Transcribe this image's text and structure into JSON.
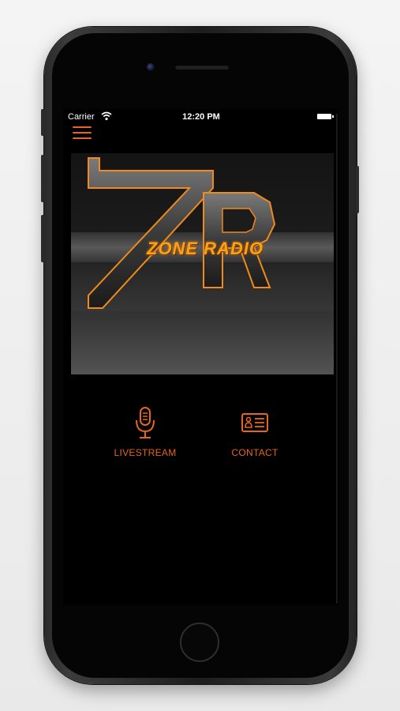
{
  "status_bar": {
    "carrier": "Carrier",
    "time": "12:20 PM"
  },
  "logo": {
    "text": "ZONE RADIO",
    "monogram": "ZR"
  },
  "nav": {
    "items": [
      {
        "label": "LIVESTREAM",
        "icon": "microphone-icon"
      },
      {
        "label": "CONTACT",
        "icon": "contact-card-icon"
      }
    ]
  },
  "colors": {
    "accent": "#e8641f",
    "logo_glow": "#f7a21b",
    "background": "#000000"
  }
}
